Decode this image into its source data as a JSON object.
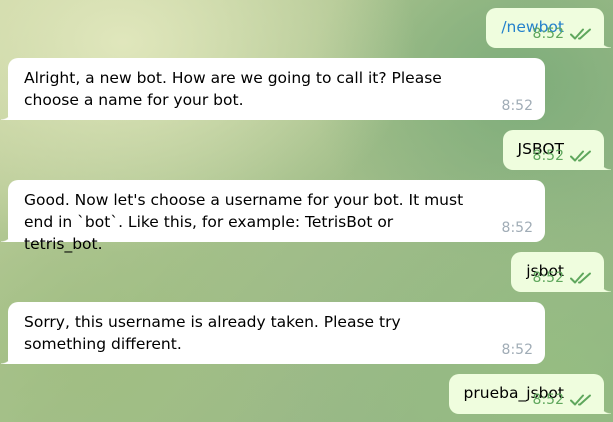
{
  "colors": {
    "incoming_bubble": "#ffffff",
    "outgoing_bubble": "#effdde",
    "time_outgoing": "#5fa75d",
    "time_incoming": "#a0acb6",
    "command_link": "#2481cc"
  },
  "messages": [
    {
      "direction": "outgoing",
      "text": "/newbot",
      "time": "8:52",
      "status_icon": "double-check-icon"
    },
    {
      "direction": "incoming",
      "text": "Alright, a new bot. How are we going to call it? Please choose a name for your bot.",
      "time": "8:52"
    },
    {
      "direction": "outgoing",
      "text": "JSBOT",
      "time": "8:52",
      "status_icon": "double-check-icon"
    },
    {
      "direction": "incoming",
      "text": "Good. Now let's choose a username for your bot. It must end in `bot`. Like this, for example: TetrisBot or tetris_bot.",
      "time": "8:52"
    },
    {
      "direction": "outgoing",
      "text": "jsbot",
      "time": "8:52",
      "status_icon": "double-check-icon"
    },
    {
      "direction": "incoming",
      "text": "Sorry, this username is already taken. Please try something different.",
      "time": "8:52"
    },
    {
      "direction": "outgoing",
      "text": "prueba_jsbot",
      "time": "8:52",
      "status_icon": "double-check-icon"
    }
  ]
}
